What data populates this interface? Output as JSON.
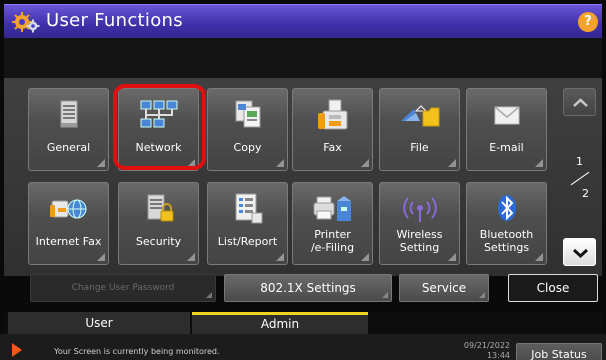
{
  "window": {
    "title": "User Functions",
    "help_label": "?"
  },
  "tiles": [
    {
      "label": "General",
      "icon": "general-icon"
    },
    {
      "label": "Network",
      "icon": "network-icon"
    },
    {
      "label": "Copy",
      "icon": "copy-icon"
    },
    {
      "label": "Fax",
      "icon": "fax-icon"
    },
    {
      "label": "File",
      "icon": "file-icon"
    },
    {
      "label": "E-mail",
      "icon": "email-icon"
    },
    {
      "label": "Internet Fax",
      "icon": "internet-fax-icon"
    },
    {
      "label": "Security",
      "icon": "security-icon"
    },
    {
      "label": "List/Report",
      "icon": "list-report-icon"
    },
    {
      "label": "Printer\n/e-Filing",
      "icon": "printer-efiling-icon"
    },
    {
      "label": "Wireless\nSetting",
      "icon": "wireless-icon"
    },
    {
      "label": "Bluetooth\nSettings",
      "icon": "bluetooth-icon"
    }
  ],
  "pagination": {
    "current": "1",
    "total": "2"
  },
  "buttons": {
    "change_password": "Change User Password",
    "dot1x": "802.1X Settings",
    "service": "Service",
    "close": "Close"
  },
  "tabs": {
    "user": "User",
    "admin": "Admin"
  },
  "status": {
    "message": "Your Screen is currently being monitored.",
    "date": "09/21/2022",
    "time": "13:44",
    "job_status": "Job Status"
  },
  "colors": {
    "title_bar": "#4a3bc0",
    "highlight": "#e01010",
    "admin_tab_accent": "#f2d21a",
    "help": "#f2a22a"
  }
}
